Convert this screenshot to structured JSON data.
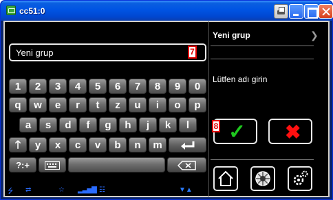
{
  "window": {
    "title": "cc51:0"
  },
  "input": {
    "value": "Yeni grup",
    "marker": "7"
  },
  "keyboard": {
    "row1": [
      "1",
      "2",
      "3",
      "4",
      "5",
      "6",
      "7",
      "8",
      "9",
      "0"
    ],
    "row2": [
      "q",
      "w",
      "e",
      "r",
      "t",
      "z",
      "u",
      "i",
      "o",
      "p"
    ],
    "row3": [
      "a",
      "s",
      "d",
      "f",
      "g",
      "h",
      "j",
      "k",
      "l"
    ],
    "row4": [
      "y",
      "x",
      "c",
      "v",
      "b",
      "n",
      "m"
    ],
    "symbols_key": "?:+"
  },
  "panel": {
    "title": "Yeni grup",
    "prompt": "Lütfen adı girin",
    "marker": "8"
  },
  "colors": {
    "accent_green": "#1ec81e",
    "accent_red": "#ff1010",
    "status_blue": "#2a6cff",
    "marker_red": "#e00000"
  },
  "icons": [
    "app-icon",
    "print-icon",
    "minimize-icon",
    "maximize-icon",
    "close-icon",
    "shift-icon",
    "enter-icon",
    "keyboard-icon",
    "backspace-icon",
    "check-icon",
    "cross-icon",
    "home-icon",
    "status-icon",
    "settings-icon",
    "chevron-right-icon"
  ]
}
